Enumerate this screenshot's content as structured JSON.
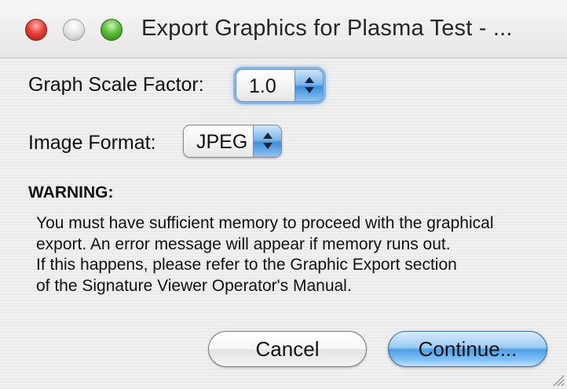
{
  "window": {
    "title": "Export Graphics for Plasma Test - ...",
    "controls": [
      "close",
      "minimize",
      "zoom"
    ]
  },
  "form": {
    "scale_label": "Graph Scale Factor:",
    "scale_value": "1.0",
    "format_label": "Image Format:",
    "format_value": "JPEG"
  },
  "warning": {
    "title": "WARNING:",
    "lines": [
      "You must have sufficient memory to proceed with the graphical",
      "export.  An error message will appear if memory runs out.",
      "If this happens, please refer to the Graphic Export section",
      "of the Signature Viewer Operator's Manual."
    ]
  },
  "buttons": {
    "cancel": "Cancel",
    "continue": "Continue..."
  },
  "colors": {
    "accent": "#4d9ee6",
    "close": "#e5433a",
    "zoom": "#5fbe3a"
  }
}
